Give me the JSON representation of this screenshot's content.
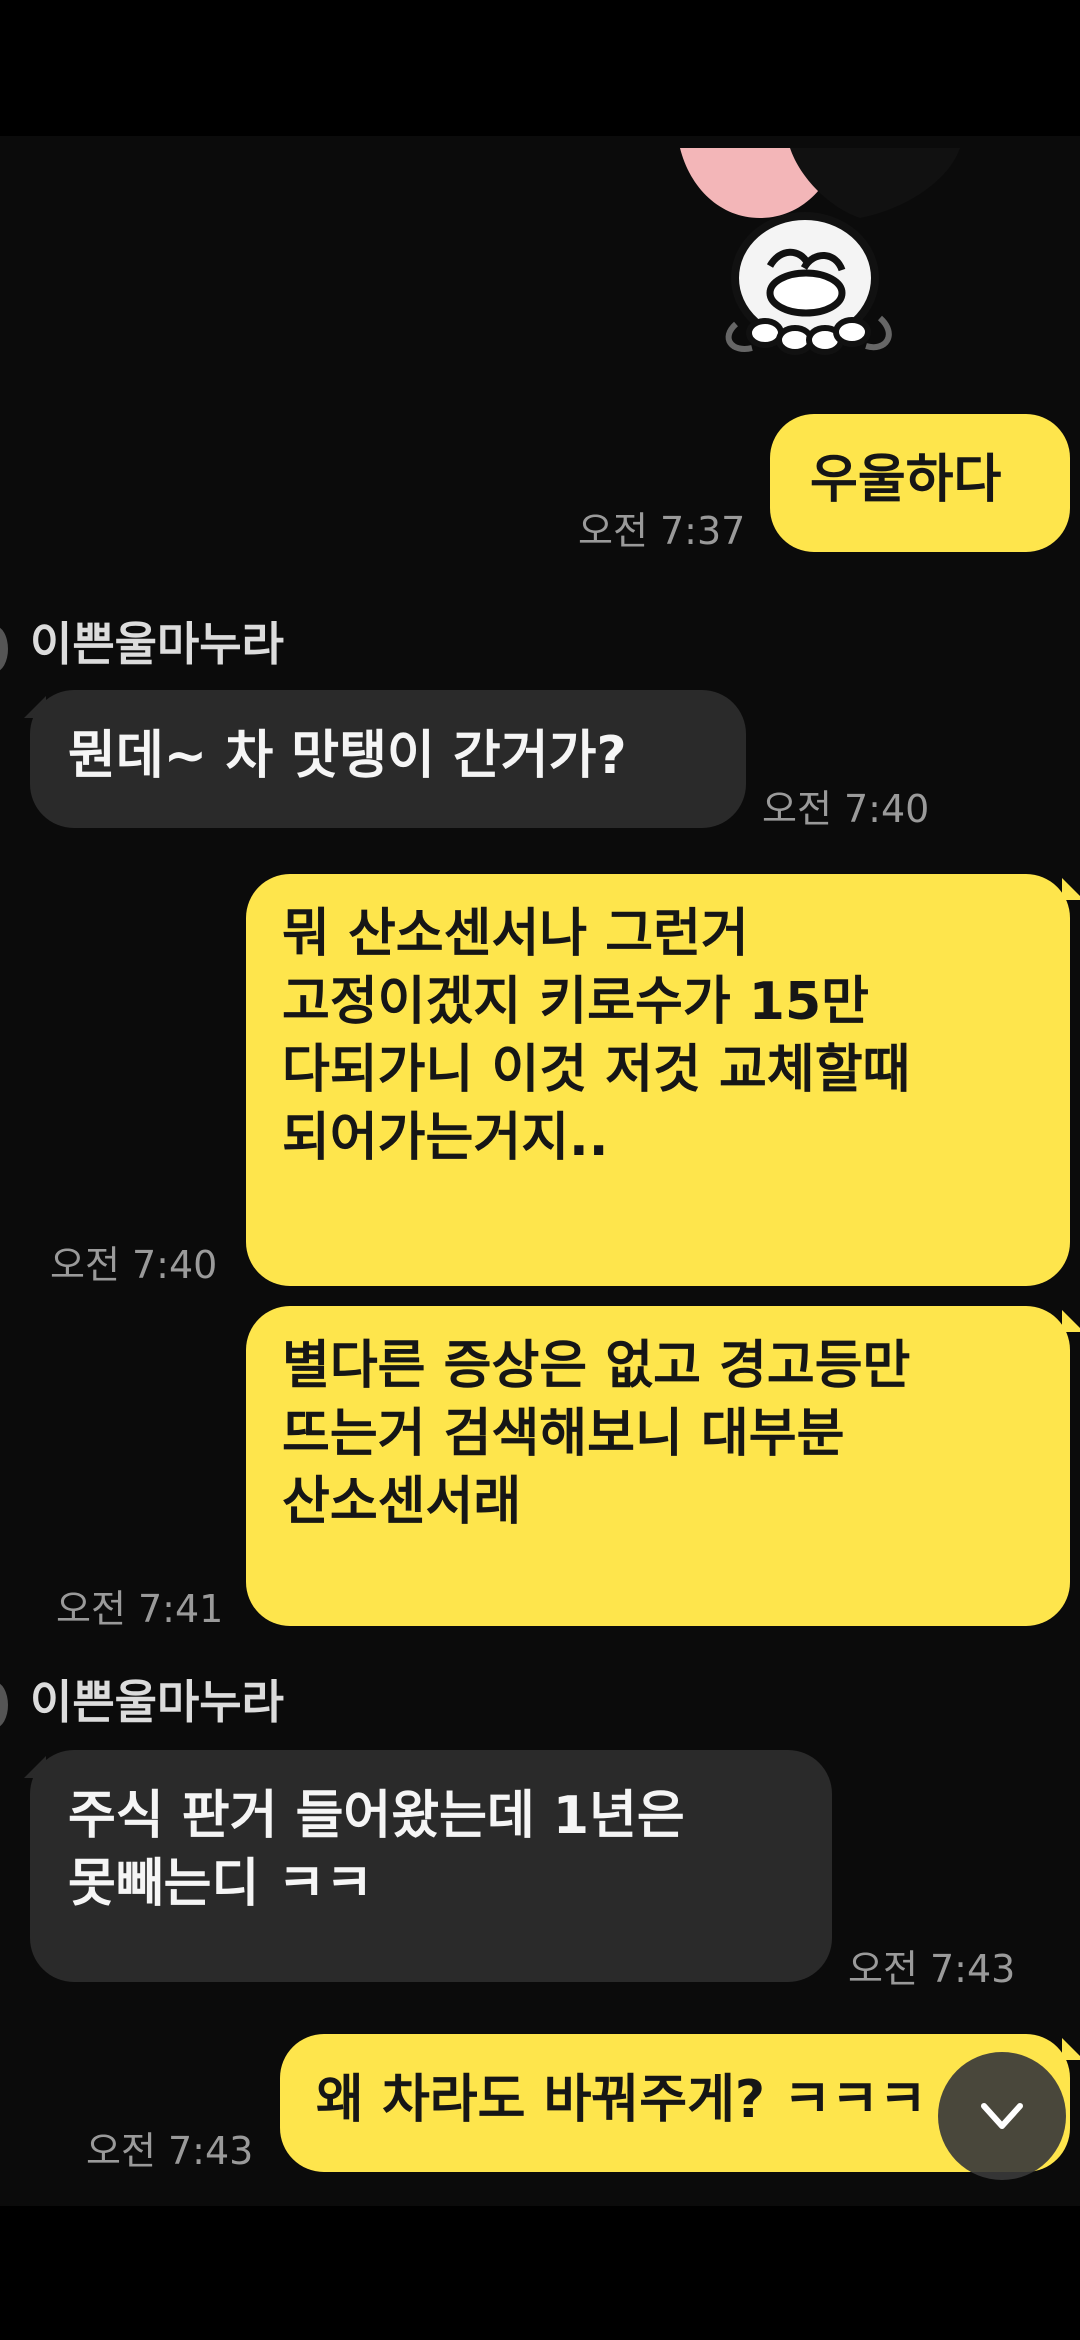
{
  "messages": [
    {
      "type": "sent",
      "text": "우울하다",
      "time": "오전 7:37"
    },
    {
      "type": "received",
      "sender": "이쁜울마누라",
      "text": "뭔데~ 차 맛탱이 간거가?",
      "time": "오전 7:40"
    },
    {
      "type": "sent",
      "text": "뭐 산소센서나 그런거\n고정이겠지 키로수가 15만\n다되가니 이것 저것 교체할때\n되어가는거지..",
      "time": "오전 7:40"
    },
    {
      "type": "sent",
      "text": "별다른 증상은 없고 경고등만\n뜨는거 검색해보니 대부분\n산소센서래",
      "time": "오전 7:41"
    },
    {
      "type": "received",
      "sender": "이쁜울마누라",
      "text": "주식 판거 들어왔는데 1년은\n못빼는디  ㅋㅋ",
      "time": "오전 7:43"
    },
    {
      "type": "sent",
      "text": "왜 차라도 바꿔주게? ㅋㅋㅋ",
      "time": "오전 7:43"
    }
  ],
  "icons": {
    "sticker": "crying-character-sticker",
    "scroll_down": "chevron-down-icon"
  },
  "colors": {
    "sent_bubble": "#fee54c",
    "received_bubble": "#2a2a2a",
    "background": "#0b0b0b"
  }
}
